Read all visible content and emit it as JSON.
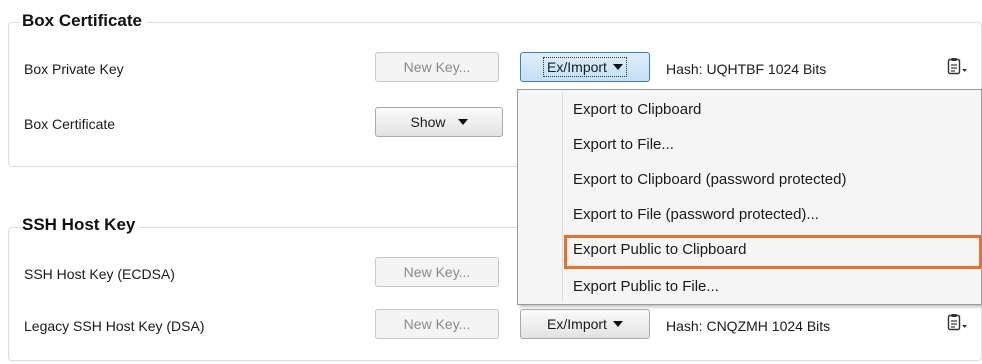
{
  "box_certificate": {
    "title": "Box Certificate",
    "private_key_label": "Box Private Key",
    "certificate_label": "Box Certificate",
    "new_key_label": "New Key...",
    "ex_import_label": "Ex/Import",
    "hash_text": "Hash: UQHTBF 1024 Bits",
    "show_label": "Show"
  },
  "ssh_host_key": {
    "title": "SSH Host Key",
    "ecdsa_label": "SSH Host Key (ECDSA)",
    "dsa_label": "Legacy SSH Host Key (DSA)",
    "new_key_label": "New Key...",
    "new_key_label_2": "New Key...",
    "ex_import_label": "Ex/Import",
    "dsa_hash_text": "Hash: CNQZMH 1024 Bits"
  },
  "menu": {
    "items": [
      "Export to Clipboard",
      "Export to File...",
      "Export to Clipboard (password protected)",
      "Export to File (password protected)...",
      "Export Public to Clipboard",
      "Export Public to File..."
    ],
    "highlighted_index": 4
  },
  "colors": {
    "highlight": "#e8712a"
  },
  "icons": {
    "clipboard": "clipboard-menu-icon",
    "dropdown": "chevron-down-icon"
  }
}
